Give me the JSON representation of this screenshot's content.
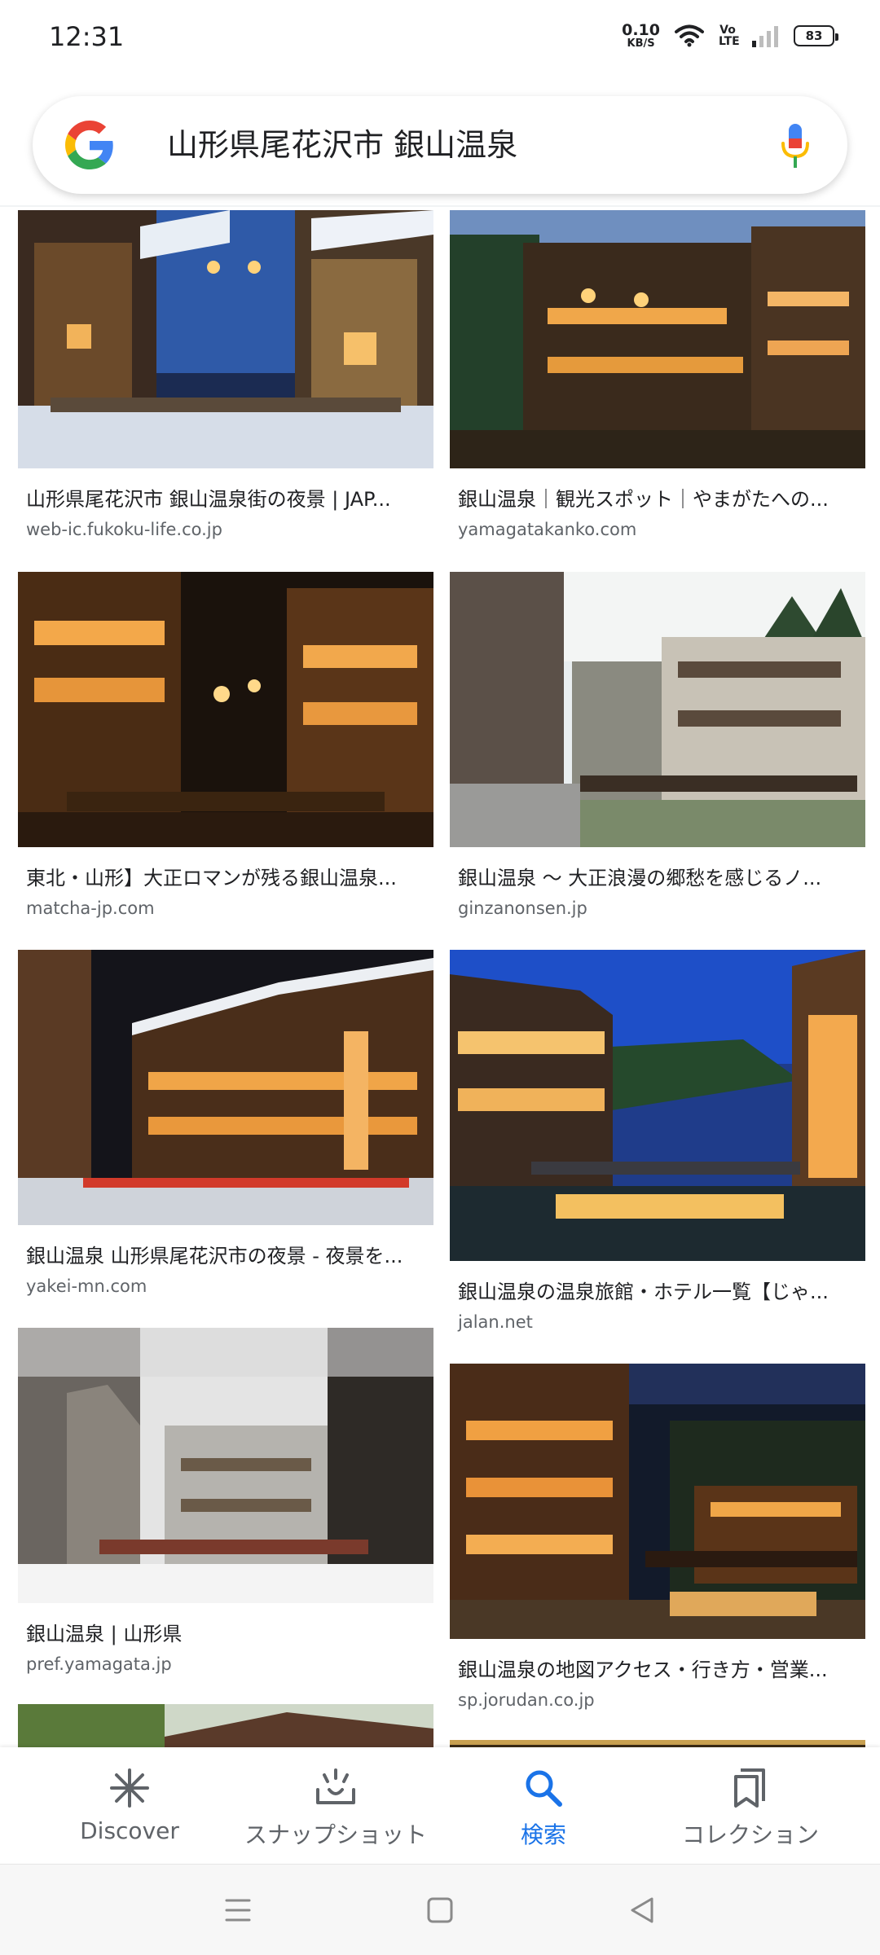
{
  "status_bar": {
    "time": "12:31",
    "net_speed_value": "0.10",
    "net_speed_unit": "KB/S",
    "volte": "Vo LTE",
    "battery": "83"
  },
  "search": {
    "query": "山形県尾花沢市  銀山温泉",
    "google_colors": [
      "#4285F4",
      "#EA4335",
      "#FBBC05",
      "#34A853"
    ]
  },
  "results": [
    {
      "title": "山形県尾花沢市 銀山温泉街の夜景 | JAP...",
      "source": "web-ic.fukoku-life.co.jp"
    },
    {
      "title": "銀山温泉｜観光スポット｜やまがたへの...",
      "source": "yamagatakanko.com"
    },
    {
      "title": "東北・山形】大正ロマンが残る銀山温泉...",
      "source": "matcha-jp.com"
    },
    {
      "title": "銀山温泉 〜 大正浪漫の郷愁を感じるノ...",
      "source": "ginzanonsen.jp"
    },
    {
      "title": "銀山温泉 山形県尾花沢市の夜景 - 夜景を...",
      "source": "yakei-mn.com"
    },
    {
      "title": "銀山温泉の温泉旅館・ホテル一覧【じゃ...",
      "source": "jalan.net"
    },
    {
      "title": "銀山温泉 | 山形県",
      "source": "pref.yamagata.jp"
    },
    {
      "title": "銀山温泉の地図アクセス・行き方・営業...",
      "source": "sp.jorudan.co.jp"
    }
  ],
  "bottom_nav": {
    "items": [
      {
        "label": "Discover",
        "icon": "asterisk-icon",
        "active": false
      },
      {
        "label": "スナップショット",
        "icon": "snapshot-icon",
        "active": false
      },
      {
        "label": "検索",
        "icon": "search-icon",
        "active": true
      },
      {
        "label": "コレクション",
        "icon": "collections-icon",
        "active": false
      }
    ],
    "active_color": "#1a73e8",
    "inactive_color": "#5f6368"
  }
}
